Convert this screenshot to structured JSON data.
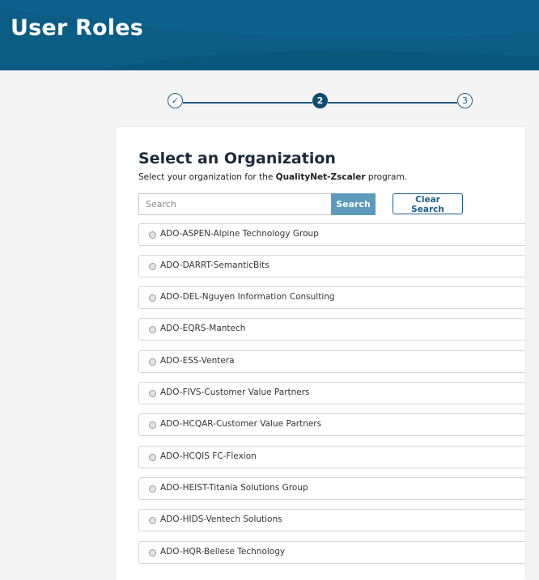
{
  "header": {
    "title": "User Roles"
  },
  "stepper": {
    "steps": [
      {
        "state": "done",
        "label": "✓"
      },
      {
        "state": "current",
        "label": "2"
      },
      {
        "state": "todo",
        "label": "3"
      }
    ]
  },
  "card": {
    "title": "Select an Organization",
    "subtitle_prefix": "Select your organization for the ",
    "subtitle_program": "QualityNet-Zscaler",
    "subtitle_suffix": " program."
  },
  "search": {
    "placeholder": "Search",
    "search_label": "Search",
    "clear_label": "Clear Search"
  },
  "organizations": [
    "ADO-ASPEN-Alpine Technology Group",
    "ADO-DARRT-SemanticBits",
    "ADO-DEL-Nguyen Information Consulting",
    "ADO-EQRS-Mantech",
    "ADO-ESS-Ventera",
    "ADO-FIVS-Customer Value Partners",
    "ADO-HCQAR-Customer Value Partners",
    "ADO-HCQIS FC-Flexion",
    "ADO-HEIST-Titania Solutions Group",
    "ADO-HIDS-Ventech Solutions",
    "ADO-HQR-Bellese Technology"
  ],
  "colors": {
    "header_bg": "#0b5d86",
    "accent": "#1b5e88",
    "search_button": "#5d9bbd"
  }
}
